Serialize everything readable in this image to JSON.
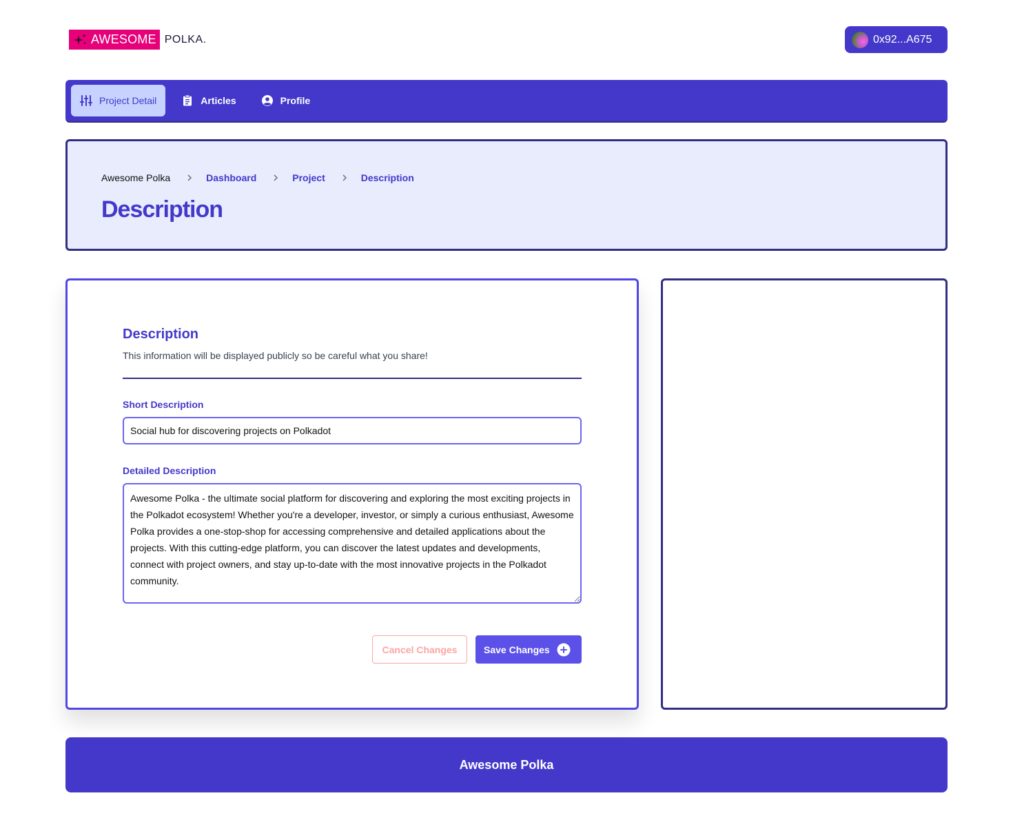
{
  "brand": {
    "logo_main": "AWESOME",
    "logo_suffix": "POLKA.",
    "primary_color": "#4338ca",
    "accent_color": "#e6007a"
  },
  "wallet": {
    "address": "0x92...A675"
  },
  "nav": {
    "items": [
      {
        "label": "Project Detail",
        "icon": "sliders-icon",
        "active": true
      },
      {
        "label": "Articles",
        "icon": "clipboard-icon",
        "active": false
      },
      {
        "label": "Profile",
        "icon": "user-circle-icon",
        "active": false
      }
    ]
  },
  "breadcrumb": [
    "Awesome Polka",
    "Dashboard",
    "Project",
    "Description"
  ],
  "page_title": "Description",
  "form": {
    "title": "Description",
    "subtitle": "This information will be displayed publicly so be careful what you share!",
    "short_label": "Short Description",
    "short_value": "Social hub for discovering projects on Polkadot",
    "detailed_label": "Detailed Description",
    "detailed_value": "Awesome Polka - the ultimate social platform for discovering and exploring the most exciting projects in the Polkadot ecosystem! Whether you're a developer, investor, or simply a curious enthusiast, Awesome Polka provides a one-stop-shop for accessing comprehensive and detailed applications about the projects. With this cutting-edge platform, you can discover the latest updates and developments, connect with project owners, and stay up-to-date with the most innovative projects in the Polkadot community.",
    "cancel_label": "Cancel Changes",
    "save_label": "Save Changes"
  },
  "footer": {
    "text": "Awesome Polka"
  }
}
